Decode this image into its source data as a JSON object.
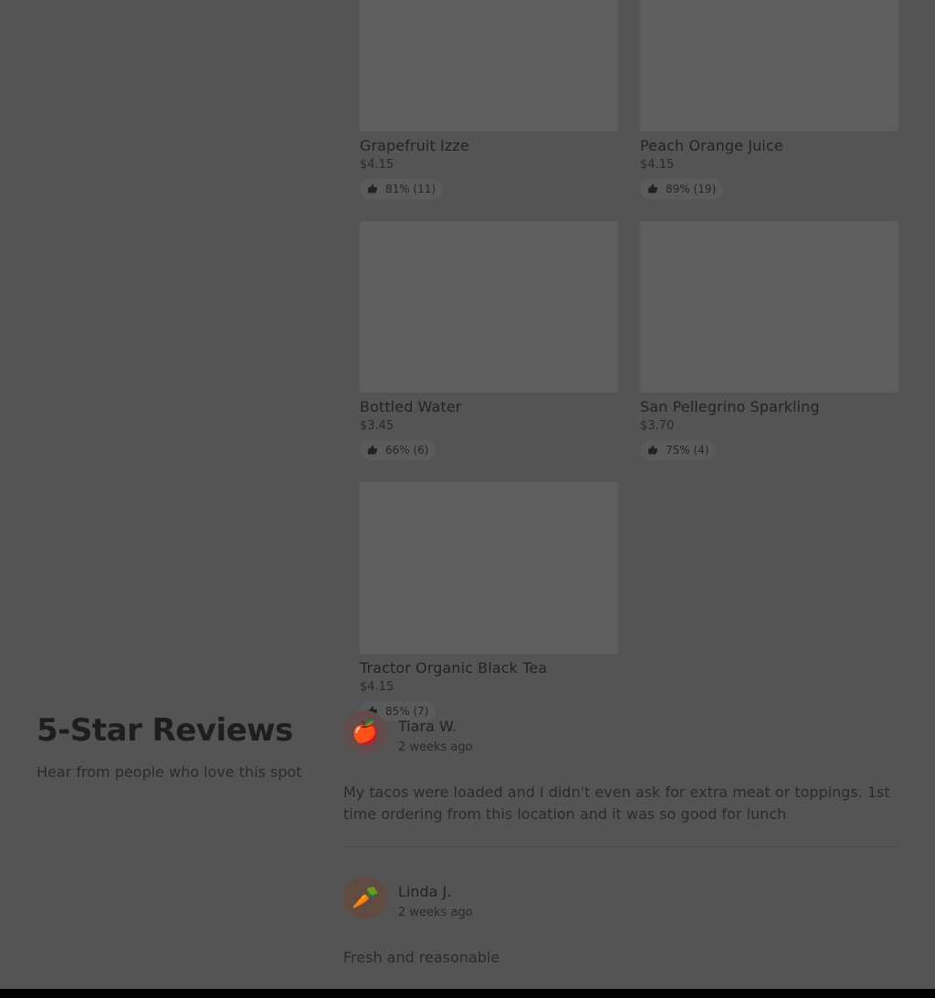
{
  "menu_items": [
    {
      "name": "Grapefruit Izze",
      "price": "$4.15",
      "rating": "81% (11)"
    },
    {
      "name": "Peach Orange Juice",
      "price": "$4.15",
      "rating": "89% (19)"
    },
    {
      "name": "Bottled Water",
      "price": "$3.45",
      "rating": "66% (6)"
    },
    {
      "name": "San Pellegrino Sparkling",
      "price": "$3.70",
      "rating": "75% (4)"
    },
    {
      "name": "Tractor Organic Black Tea",
      "price": "$4.15",
      "rating": "85% (7)"
    }
  ],
  "reviews_section": {
    "title": "5-Star Reviews",
    "subtitle": "Hear from people who love this spot",
    "reviews": [
      {
        "avatar_icon": "apple-icon",
        "avatar_glyph": "🍎",
        "name": "Tiara W.",
        "time": "2 weeks ago",
        "text": "My tacos were loaded and I didn't even ask for extra meat or toppings. 1st time ordering from this location and it was so good for lunch"
      },
      {
        "avatar_icon": "carrot-icon",
        "avatar_glyph": "🥕",
        "name": "Linda J.",
        "time": "2 weeks ago",
        "text": "Fresh and reasonable"
      }
    ]
  },
  "colors": {
    "overlay_background": "#545454",
    "image_placeholder": "#5e5e5e"
  }
}
